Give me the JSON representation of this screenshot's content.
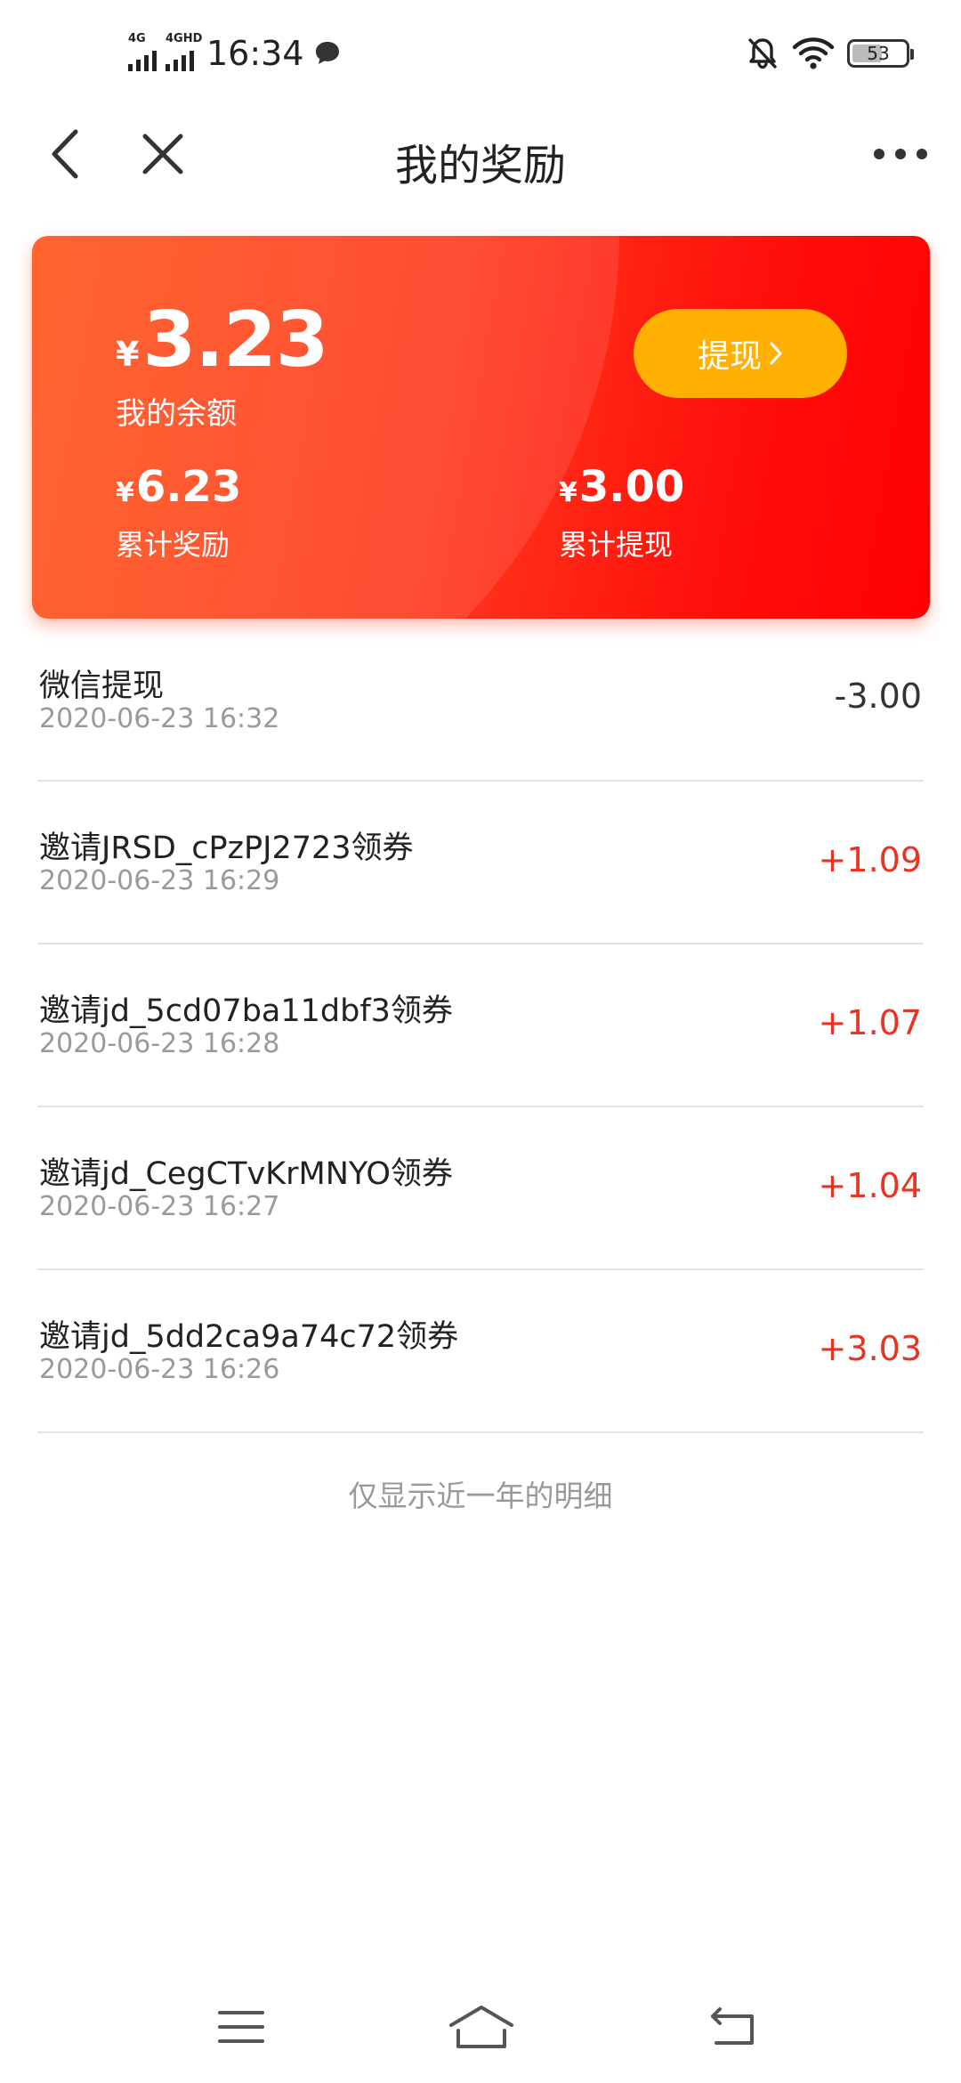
{
  "status_bar": {
    "signal1_label": "4G",
    "signal2_label": "4GHD",
    "time": "16:34",
    "battery_level": "53",
    "icons": [
      "signal-icon",
      "message-icon",
      "mute-bell-icon",
      "wifi-icon",
      "battery-icon"
    ]
  },
  "header": {
    "title": "我的奖励",
    "icons": [
      "back-arrow-icon",
      "close-icon",
      "more-dots-icon"
    ]
  },
  "balance_card": {
    "currency_symbol": "¥",
    "balance": "3.23",
    "balance_label": "我的余额",
    "withdraw_label": "提现",
    "withdraw_chevron": "›",
    "total_reward": "6.23",
    "total_reward_label": "累计奖励",
    "total_withdrawn": "3.00",
    "total_withdrawn_label": "累计提现",
    "colors": {
      "gradient_start": "#ff5418",
      "gradient_end": "#ff0000",
      "button": "#ffb000"
    }
  },
  "records": [
    {
      "title": "微信提现",
      "time": "2020-06-23 16:32",
      "amount": "-3.00"
    },
    {
      "title": "邀请JRSD_cPzPJ2723领券",
      "time": "2020-06-23 16:29",
      "amount": "+1.09"
    },
    {
      "title": "邀请jd_5cd07ba11dbf3领券",
      "time": "2020-06-23 16:28",
      "amount": "+1.07"
    },
    {
      "title": "邀请jd_CegCTvKrMNYO领券",
      "time": "2020-06-23 16:27",
      "amount": "+1.04"
    },
    {
      "title": "邀请jd_5dd2ca9a74c72领券",
      "time": "2020-06-23 16:26",
      "amount": "+3.03"
    }
  ],
  "amount_colors": {
    "negative": "#333333",
    "positive": "#e93323"
  },
  "footer_note": "仅显示近一年的明细",
  "bottom_nav": {
    "icons": [
      "menu-icon",
      "home-icon",
      "return-icon"
    ]
  }
}
